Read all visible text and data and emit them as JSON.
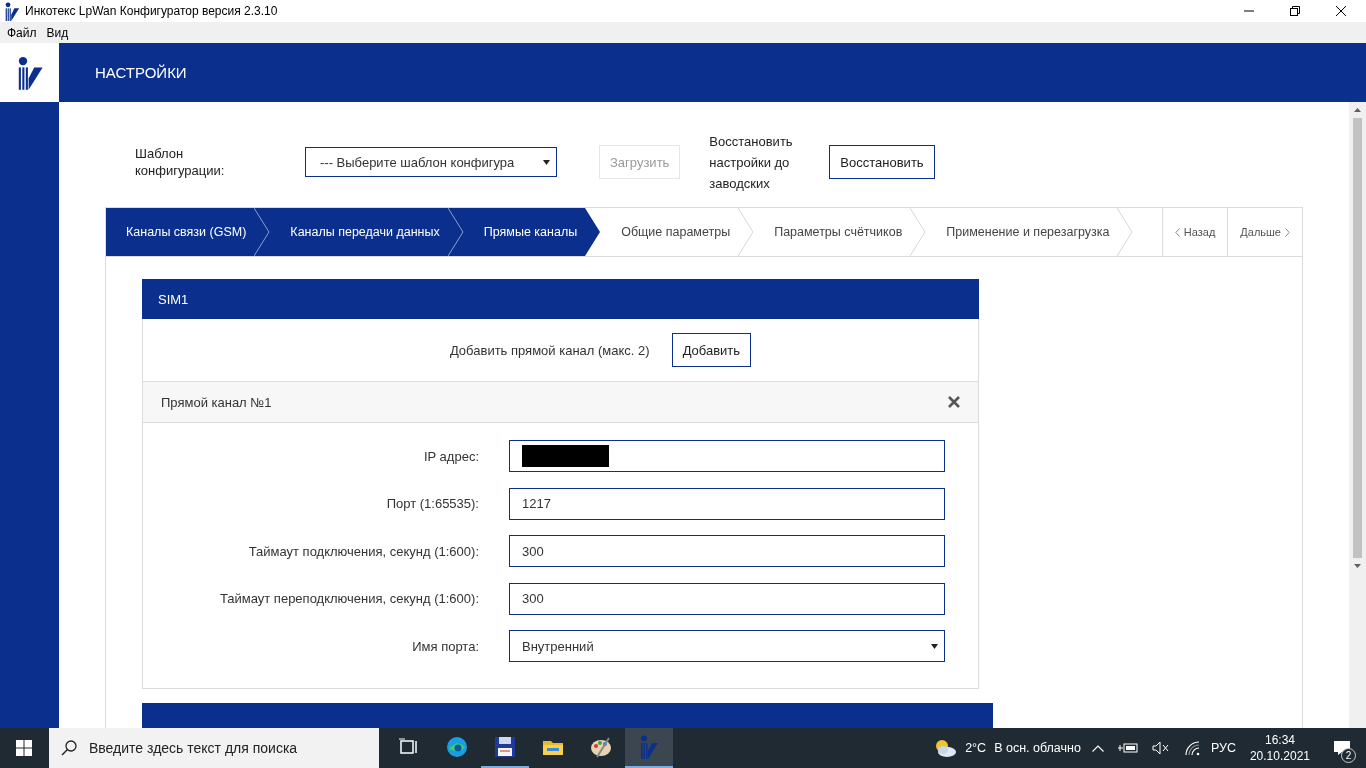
{
  "window": {
    "title": "Инкотекс LpWan Конфигуратор версия 2.3.10"
  },
  "menu": [
    "Файл",
    "Вид"
  ],
  "header": {
    "title": "НАСТРОЙКИ"
  },
  "toolbar": {
    "template_label": "Шаблон конфигурации:",
    "template_select": "--- Выберите шаблон конфигура",
    "load_button": {
      "label": "Загрузить",
      "disabled": true
    },
    "restore_label": "Восстановить настройки до заводских",
    "restore_button": "Восстановить"
  },
  "steps": [
    {
      "label": "Каналы связи (GSM)",
      "completed": true
    },
    {
      "label": "Каналы передачи данных",
      "completed": true
    },
    {
      "label": "Прямые каналы",
      "completed": true
    },
    {
      "label": "Общие параметры",
      "completed": false
    },
    {
      "label": "Параметры счётчиков",
      "completed": false
    },
    {
      "label": "Применение и перезагрузка",
      "completed": false
    }
  ],
  "nav": {
    "back": "Назад",
    "next": "Дальше"
  },
  "sim_cards": [
    {
      "title": "SIM1",
      "add_label": "Добавить прямой канал (макс. 2)",
      "add_button": "Добавить",
      "channels": [
        {
          "title": "Прямой канал №1",
          "fields": [
            {
              "kind": "redacted",
              "label": "IP адрес:"
            },
            {
              "kind": "text",
              "label": "Порт (1:65535):",
              "value": "1217"
            },
            {
              "kind": "text",
              "label": "Таймаут подключения, секунд (1:600):",
              "value": "300"
            },
            {
              "kind": "text",
              "label": "Таймаут переподключения, секунд (1:600):",
              "value": "300"
            },
            {
              "kind": "select",
              "label": "Имя порта:",
              "value": "Внутренний"
            }
          ]
        }
      ]
    },
    {
      "kind": "header_only"
    }
  ],
  "taskbar": {
    "search_placeholder": "Введите здесь текст для поиска",
    "weather_temp": "2°C",
    "weather_text": "В осн. облачно",
    "language": "РУС",
    "time": "16:34",
    "date": "20.10.2021",
    "notifications": "2"
  }
}
